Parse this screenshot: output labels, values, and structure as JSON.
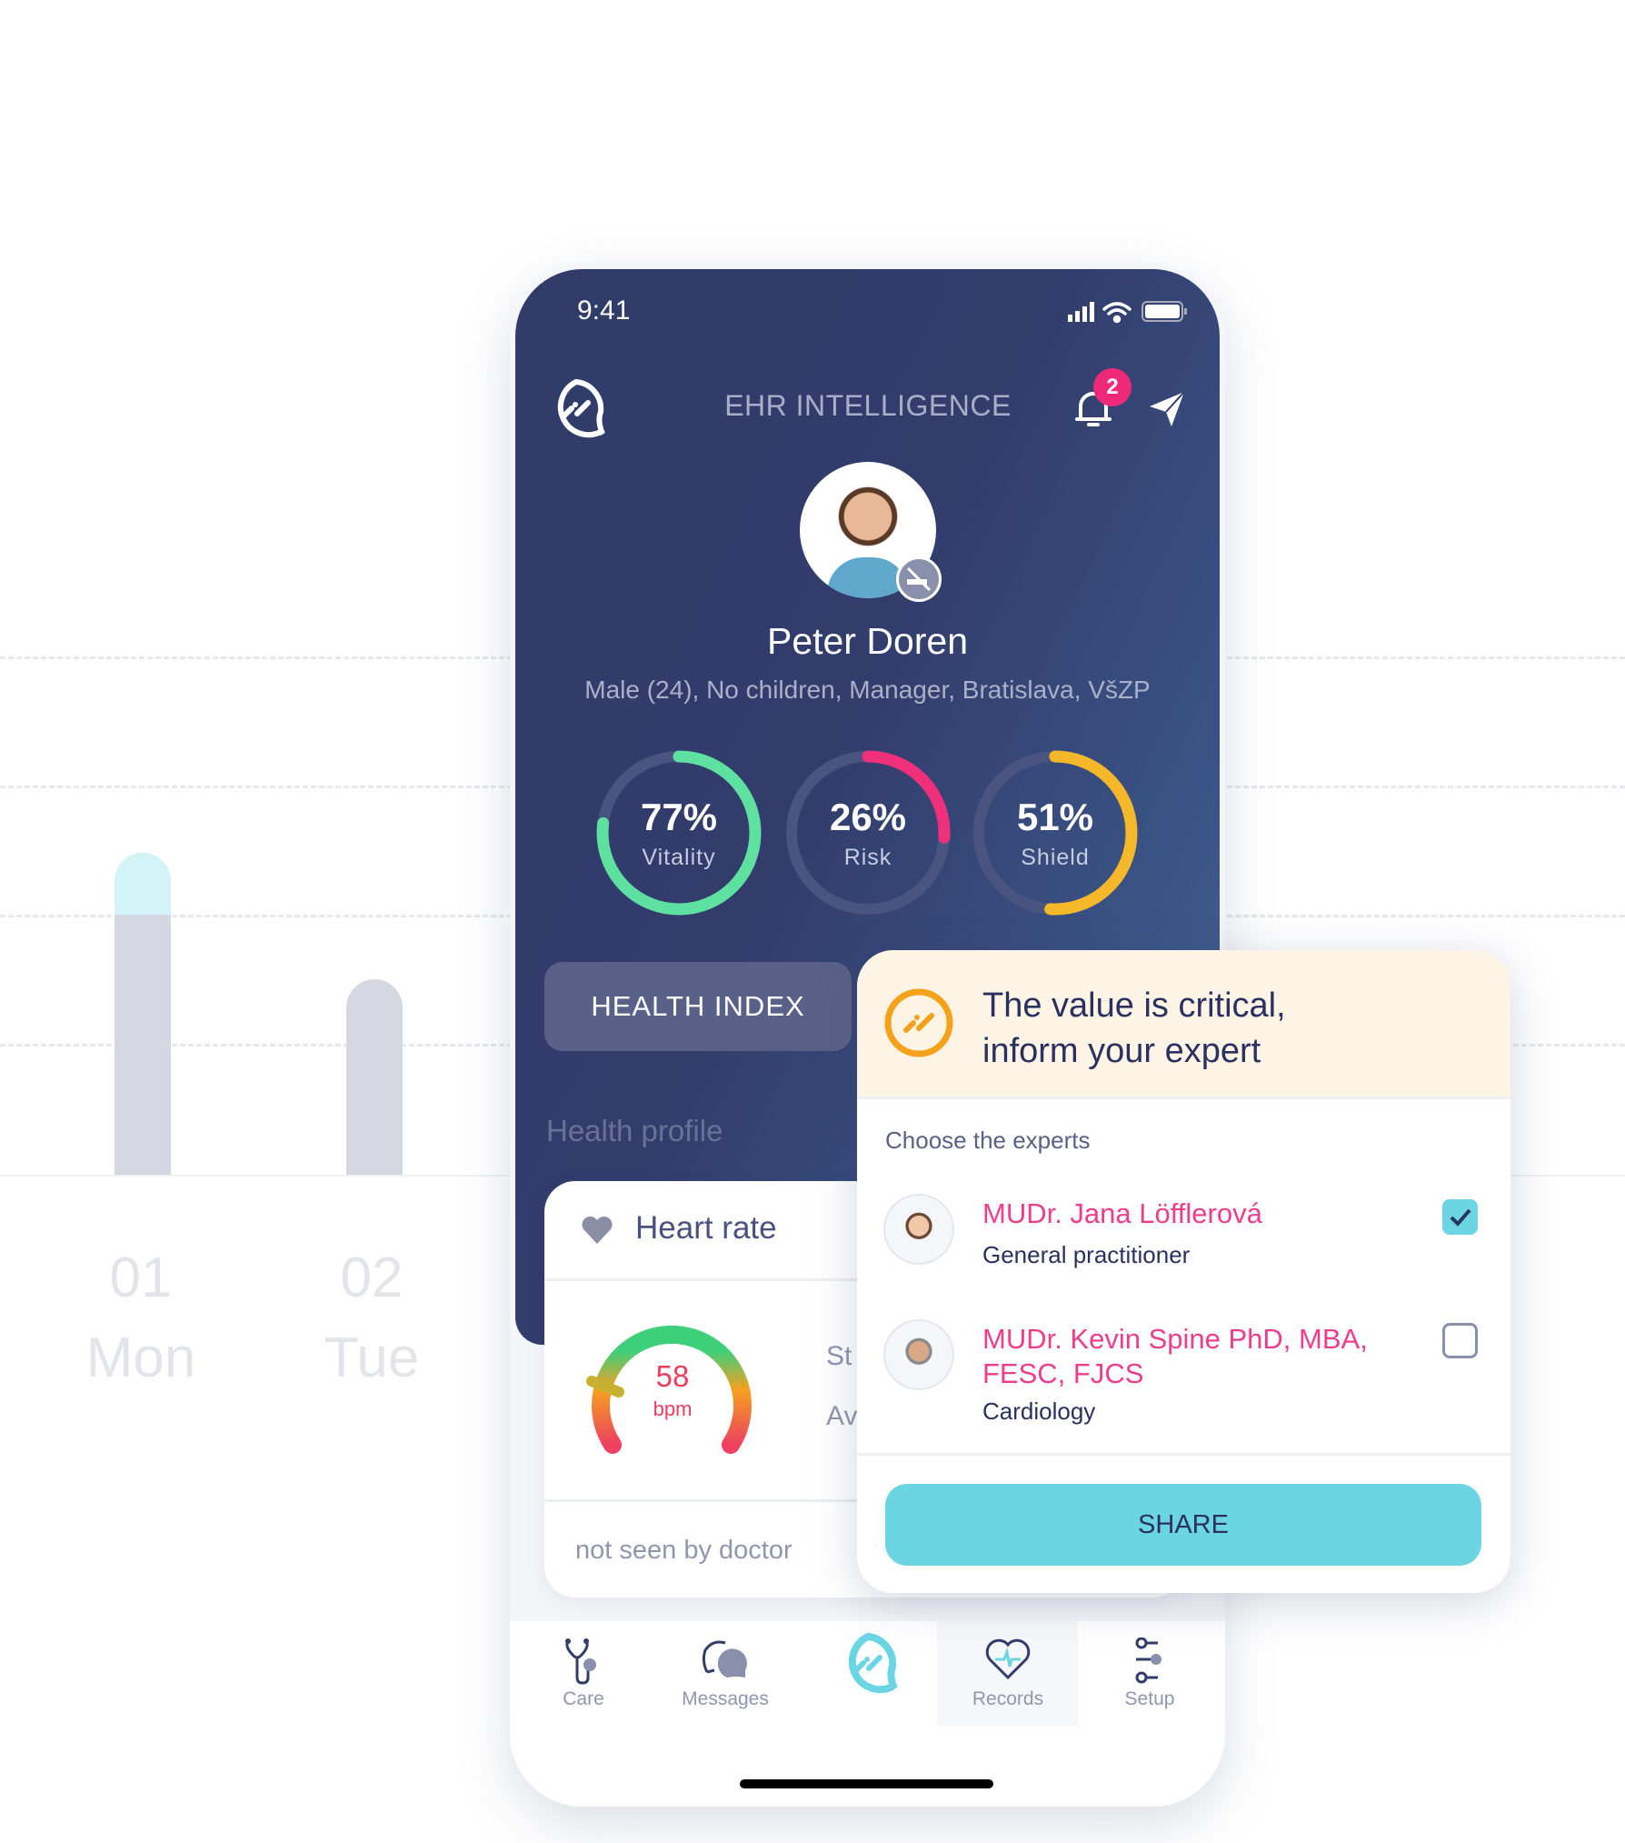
{
  "background_chart": {
    "days": [
      {
        "num": "01",
        "name": "Mon"
      },
      {
        "num": "02",
        "name": "Tue"
      }
    ]
  },
  "status_bar": {
    "time": "9:41",
    "icons": [
      "signal-icon",
      "wifi-icon",
      "battery-icon"
    ]
  },
  "header": {
    "title": "EHR INTELLIGENCE",
    "notification_count": "2",
    "logo": "ehr-logo-icon"
  },
  "profile": {
    "name": "Peter Doren",
    "details": "Male (24), No children, Manager, Bratislava, VšZP",
    "badge_icon": "no-smoking-icon"
  },
  "scores": [
    {
      "value": "77%",
      "label": "Vitality",
      "percent": 77,
      "color": "#5ee0a0"
    },
    {
      "value": "26%",
      "label": "Risk",
      "percent": 26,
      "color": "#f0307a"
    },
    {
      "value": "51%",
      "label": "Shield",
      "percent": 51,
      "color": "#f5b82a"
    }
  ],
  "health_index_button": "HEALTH INDEX",
  "health_profile": {
    "title": "Health profile",
    "card": {
      "title": "Heart rate",
      "value": "58",
      "unit": "bpm",
      "side_labels": [
        "St",
        "Av"
      ],
      "footer": "not seen by doctor"
    }
  },
  "tabbar": [
    {
      "label": "Care",
      "icon": "stethoscope-icon"
    },
    {
      "label": "Messages",
      "icon": "messages-icon"
    },
    {
      "label": "",
      "icon": "ehr-logo-icon"
    },
    {
      "label": "Records",
      "icon": "heart-records-icon"
    },
    {
      "label": "Setup",
      "icon": "sliders-icon"
    }
  ],
  "popup": {
    "title_line1": "The value is critical,",
    "title_line2": "inform your expert",
    "subtitle": "Choose the experts",
    "experts": [
      {
        "name_line1": "MUDr. Jana Löfflerová",
        "name_line2": "",
        "role": "General practitioner",
        "checked": true
      },
      {
        "name_line1": "MUDr. Kevin Spine PhD, MBA,",
        "name_line2": "FESC, FJCS",
        "role": "Cardiology",
        "checked": false
      }
    ],
    "share_button": "SHARE"
  },
  "colors": {
    "navy": "#323d6c",
    "accent_cyan": "#6bd5e4",
    "pink": "#ee3d8c",
    "orange": "#f5a21a",
    "cream": "#fdf4e6"
  }
}
